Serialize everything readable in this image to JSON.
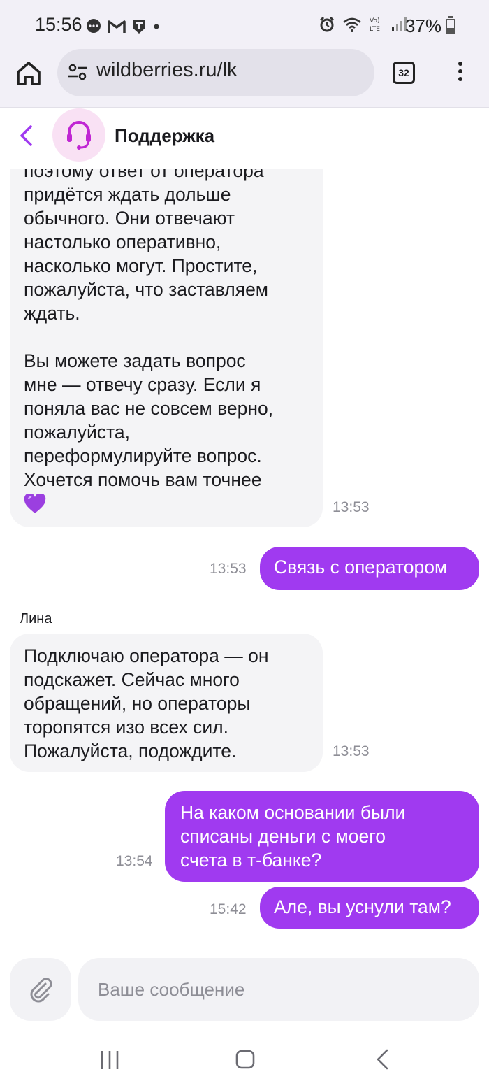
{
  "status_bar": {
    "time": "15:56",
    "battery": "37%",
    "battery_level": 0.37
  },
  "browser": {
    "url": "wildberries.ru/lk",
    "tab_count": "32"
  },
  "chat_header": {
    "title": "Поддержка",
    "avatar_icon": "headset-icon"
  },
  "messages": [
    {
      "direction": "incoming",
      "paragraphs": [
        [
          "поэтому ответ от оператора",
          "придётся ждать дольше",
          "обычного. Они отвечают",
          "настолько оперативно,",
          "насколько могут. Простите,",
          "пожалуйста, что заставляем",
          "ждать."
        ],
        [
          "Вы можете задать вопрос",
          "мне — отвечу сразу. Если я",
          "поняла вас не совсем верно,",
          "пожалуйста,",
          "переформулируйте вопрос.",
          "Хочется помочь вам точнее"
        ]
      ],
      "emoji": "purple-heart-icon",
      "time": "13:53"
    },
    {
      "direction": "outgoing",
      "lines": [
        "Связь с оператором"
      ],
      "time": "13:53"
    },
    {
      "direction": "incoming",
      "sender": "Лина",
      "lines": [
        "Подключаю оператора — он",
        "подскажет. Сейчас много",
        "обращений, но операторы",
        "торопятся изо всех сил.",
        "Пожалуйста, подождите."
      ],
      "time": "13:53"
    },
    {
      "direction": "outgoing",
      "lines": [
        "На каком основании были",
        "списаны деньги с моего",
        "счета в т-банке?"
      ],
      "time": "13:54"
    },
    {
      "direction": "outgoing",
      "lines": [
        "Але, вы уснули там?"
      ],
      "time": "15:42"
    }
  ],
  "composer": {
    "placeholder": "Ваше сообщение",
    "value": ""
  },
  "colors": {
    "accent": "#a03af0",
    "incoming_bubble": "#f4f4f6",
    "header_icon": "#c026d3"
  }
}
